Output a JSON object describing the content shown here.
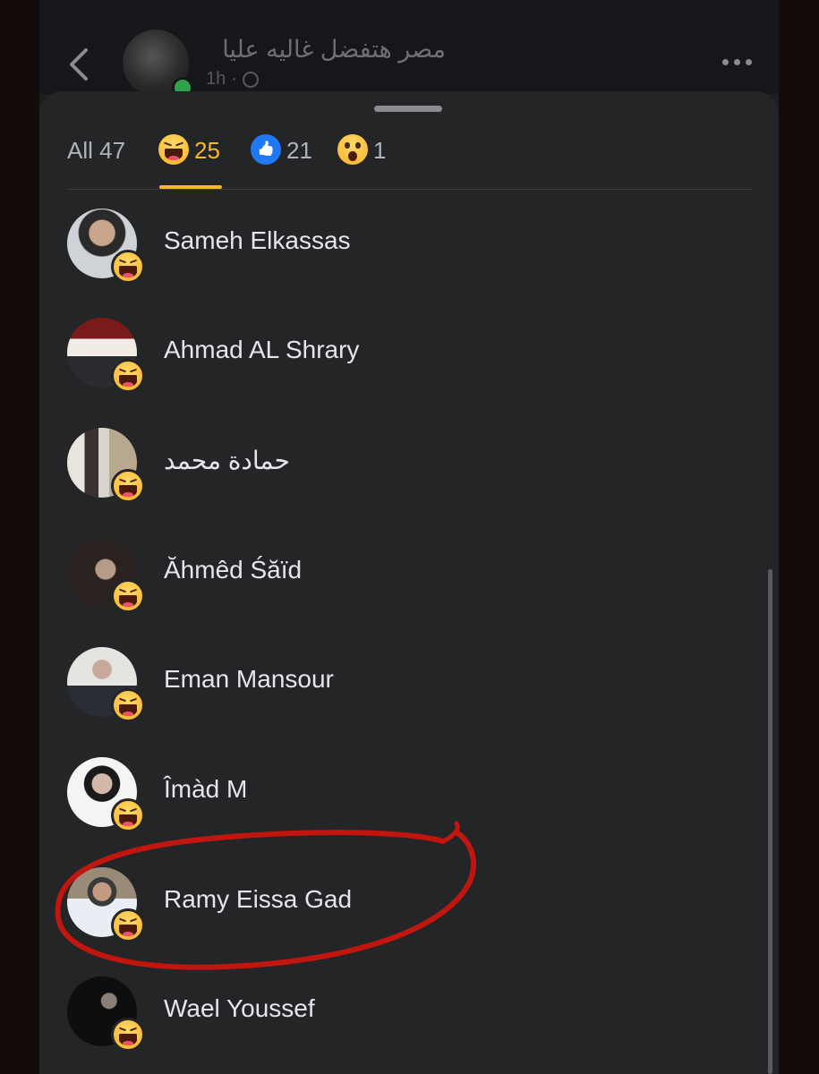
{
  "post": {
    "title": "مصر هتفضل غاليه عليا",
    "time": "1h",
    "separator": "·"
  },
  "tabs": [
    {
      "label": "All 47",
      "icon": "",
      "active": false
    },
    {
      "label": "25",
      "icon": "haha-reaction-icon",
      "active": true
    },
    {
      "label": "21",
      "icon": "like-reaction-icon",
      "active": false
    },
    {
      "label": "1",
      "icon": "wow-reaction-icon",
      "active": false
    }
  ],
  "reactors": [
    {
      "name": "Sameh Elkassas",
      "reaction": "haha"
    },
    {
      "name": "Ahmad AL Shrary",
      "reaction": "haha"
    },
    {
      "name": "حمادة محمد",
      "reaction": "haha"
    },
    {
      "name": "Ăhmêd Śăïd",
      "reaction": "haha"
    },
    {
      "name": "Eman Mansour",
      "reaction": "haha"
    },
    {
      "name": "Îmàd M",
      "reaction": "haha"
    },
    {
      "name": "Ramy Eissa Gad",
      "reaction": "haha"
    },
    {
      "name": "Wael Youssef",
      "reaction": "haha"
    }
  ],
  "colors": {
    "sheet_bg": "#242527",
    "accent_haha": "#f7b928",
    "like_blue": "#2078f4",
    "annotation_red": "#c0160f"
  }
}
